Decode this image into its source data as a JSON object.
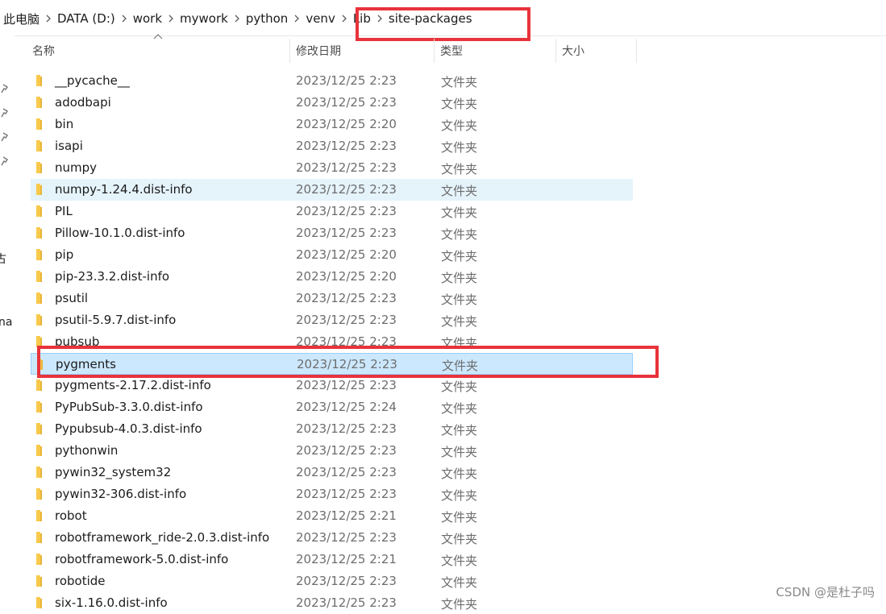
{
  "breadcrumb": [
    "此电脑",
    "DATA (D:)",
    "work",
    "mywork",
    "python",
    "venv",
    "Lib",
    "site-packages"
  ],
  "columns": {
    "name": "名称",
    "date": "修改日期",
    "type": "类型",
    "size": "大小"
  },
  "left_pane_fragments": [
    "古",
    "na"
  ],
  "files": [
    {
      "name": "__pycache__",
      "date": "2023/12/25 2:23",
      "type": "文件夹"
    },
    {
      "name": "adodbapi",
      "date": "2023/12/25 2:23",
      "type": "文件夹"
    },
    {
      "name": "bin",
      "date": "2023/12/25 2:20",
      "type": "文件夹"
    },
    {
      "name": "isapi",
      "date": "2023/12/25 2:23",
      "type": "文件夹"
    },
    {
      "name": "numpy",
      "date": "2023/12/25 2:23",
      "type": "文件夹"
    },
    {
      "name": "numpy-1.24.4.dist-info",
      "date": "2023/12/25 2:23",
      "type": "文件夹",
      "state": "hover"
    },
    {
      "name": "PIL",
      "date": "2023/12/25 2:23",
      "type": "文件夹"
    },
    {
      "name": "Pillow-10.1.0.dist-info",
      "date": "2023/12/25 2:23",
      "type": "文件夹"
    },
    {
      "name": "pip",
      "date": "2023/12/25 2:20",
      "type": "文件夹"
    },
    {
      "name": "pip-23.3.2.dist-info",
      "date": "2023/12/25 2:20",
      "type": "文件夹"
    },
    {
      "name": "psutil",
      "date": "2023/12/25 2:23",
      "type": "文件夹"
    },
    {
      "name": "psutil-5.9.7.dist-info",
      "date": "2023/12/25 2:23",
      "type": "文件夹"
    },
    {
      "name": "pubsub",
      "date": "2023/12/25 2:23",
      "type": "文件夹"
    },
    {
      "name": "pygments",
      "date": "2023/12/25 2:23",
      "type": "文件夹",
      "state": "selected"
    },
    {
      "name": "pygments-2.17.2.dist-info",
      "date": "2023/12/25 2:23",
      "type": "文件夹"
    },
    {
      "name": "PyPubSub-3.3.0.dist-info",
      "date": "2023/12/25 2:24",
      "type": "文件夹"
    },
    {
      "name": "Pypubsub-4.0.3.dist-info",
      "date": "2023/12/25 2:23",
      "type": "文件夹"
    },
    {
      "name": "pythonwin",
      "date": "2023/12/25 2:23",
      "type": "文件夹"
    },
    {
      "name": "pywin32_system32",
      "date": "2023/12/25 2:23",
      "type": "文件夹"
    },
    {
      "name": "pywin32-306.dist-info",
      "date": "2023/12/25 2:23",
      "type": "文件夹"
    },
    {
      "name": "robot",
      "date": "2023/12/25 2:21",
      "type": "文件夹"
    },
    {
      "name": "robotframework_ride-2.0.3.dist-info",
      "date": "2023/12/25 2:23",
      "type": "文件夹"
    },
    {
      "name": "robotframework-5.0.dist-info",
      "date": "2023/12/25 2:21",
      "type": "文件夹"
    },
    {
      "name": "robotide",
      "date": "2023/12/25 2:23",
      "type": "文件夹"
    },
    {
      "name": "six-1.16.0.dist-info",
      "date": "2023/12/25 2:23",
      "type": "文件夹"
    }
  ],
  "watermark": "CSDN @是杜子吗",
  "colors": {
    "annotation": "#e8333a",
    "selected_bg": "#cce8ff",
    "hover_bg": "#e5f3fb",
    "folder": "#f8c94a"
  },
  "icons": {
    "folder": "folder-icon",
    "pin": "pin-icon",
    "separator": "chevron-right-icon",
    "sort": "sort-up-icon"
  }
}
